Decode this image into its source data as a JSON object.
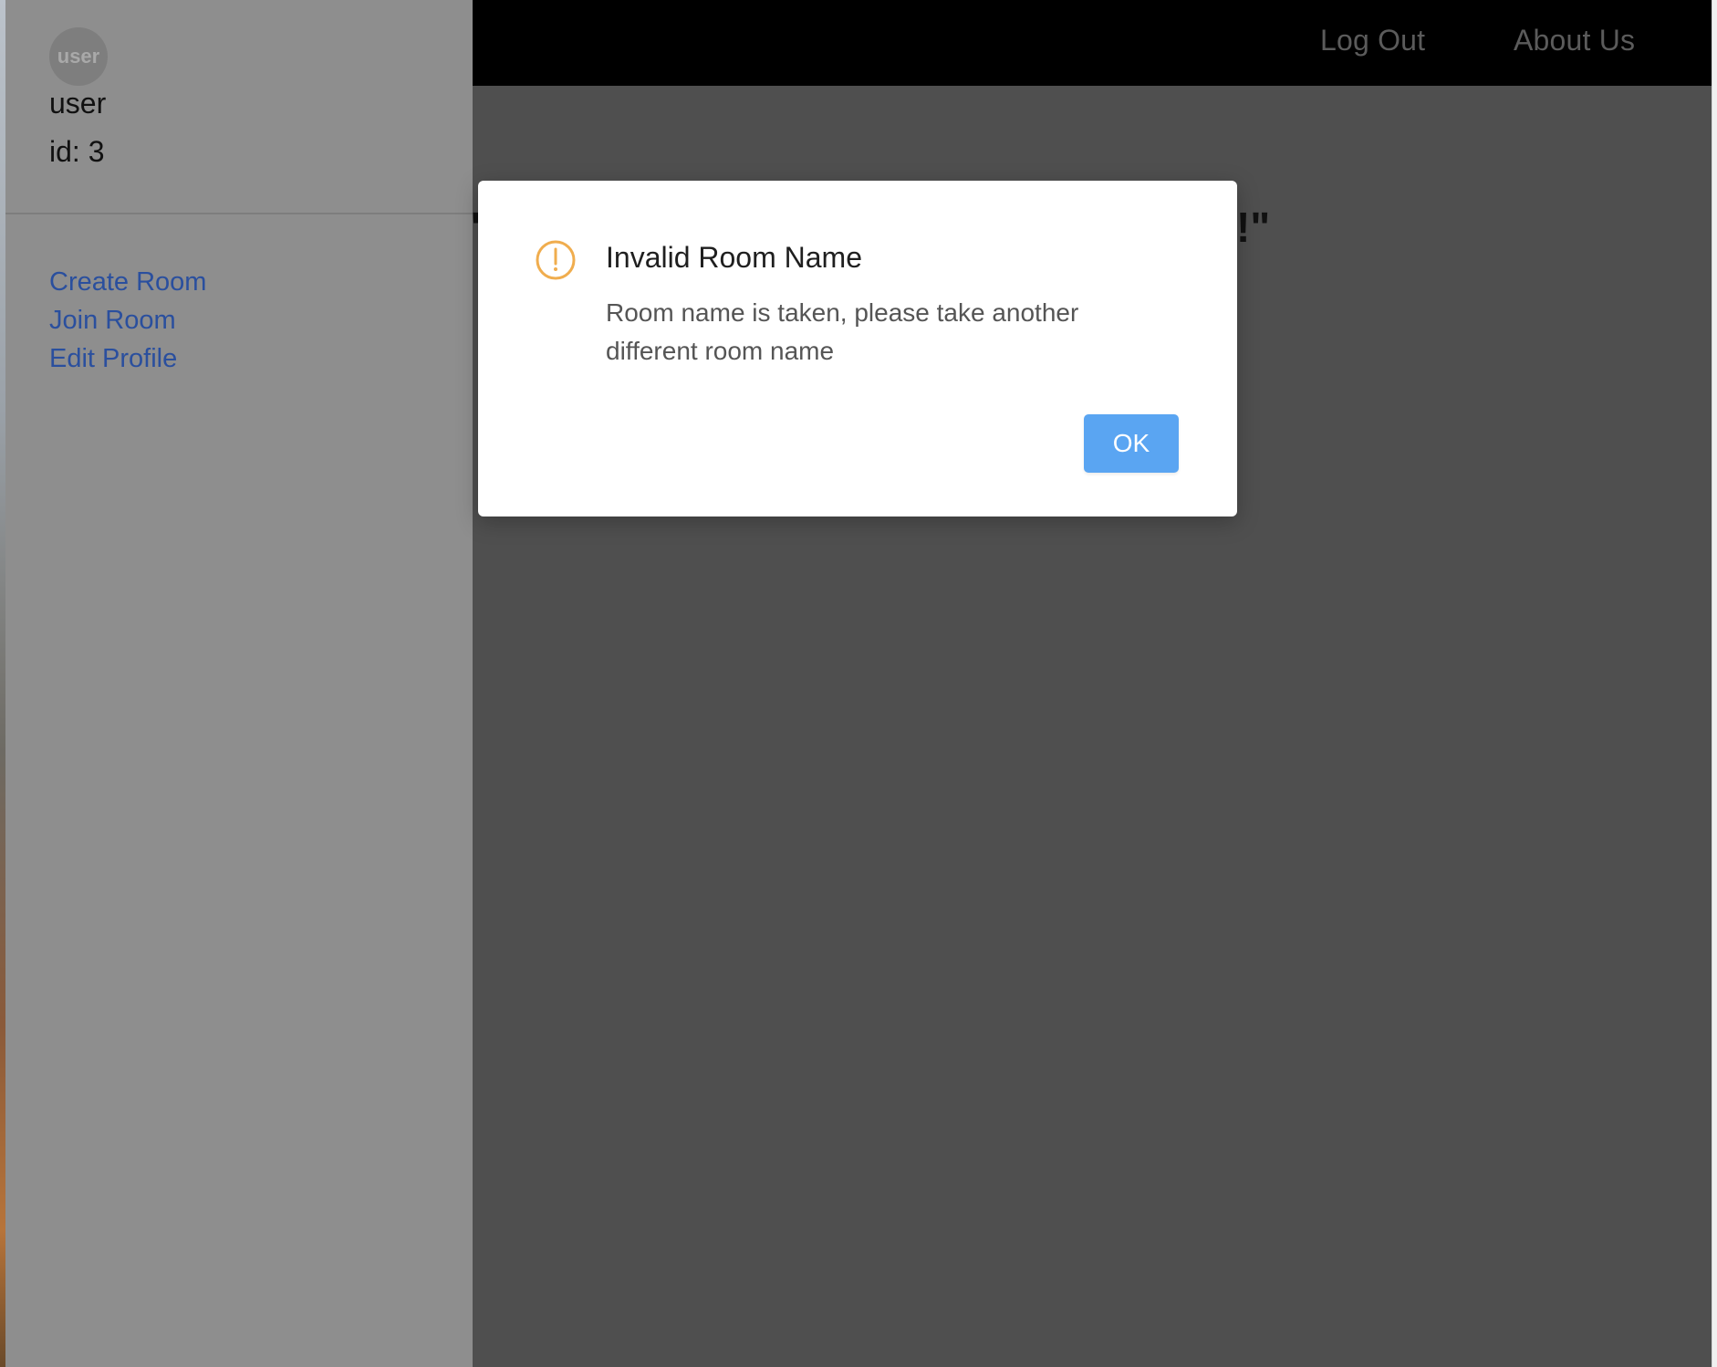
{
  "header": {
    "logout_label": "Log Out",
    "about_label": "About Us"
  },
  "background_text": {
    "left_fragment": "'",
    "right_fragment": "!\""
  },
  "sidebar": {
    "avatar_text": "user",
    "username": "user",
    "user_id": "id: 3",
    "items": [
      {
        "label": "Create Room"
      },
      {
        "label": "Join Room"
      },
      {
        "label": "Edit Profile"
      }
    ]
  },
  "modal": {
    "icon": "warning-circle-icon",
    "title": "Invalid Room Name",
    "message": "Room name is taken, please take another different room name",
    "ok_label": "OK"
  },
  "colors": {
    "link": "#2a4f9e",
    "ok_button": "#5aa5f2",
    "warning": "#f0ad4e",
    "overlay": "#4f4f4f"
  }
}
